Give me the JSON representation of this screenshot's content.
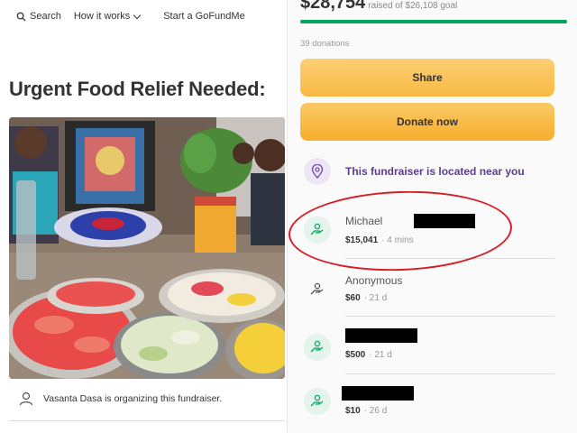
{
  "nav": {
    "search_label": "Search",
    "how_it_works_label": "How it works",
    "start_label": "Start a GoFundMe"
  },
  "campaign": {
    "title": "Urgent Food Relief Needed:",
    "organizer_text": "Vasanta Dasa is organizing this fundraiser."
  },
  "summary": {
    "raised": "$28,754",
    "goal_text": "raised of $26,108 goal",
    "progress_fraction": 1.0,
    "donations_text": "39 donations"
  },
  "buttons": {
    "share_label": "Share",
    "donate_label": "Donate now"
  },
  "location_text": "This fundraiser is located near you",
  "donors": [
    {
      "name": "Michael",
      "amount": "$15,041",
      "time": "4 mins",
      "redacted": true,
      "highlighted": true
    },
    {
      "name": "Anonymous",
      "amount": "$60",
      "time": "21 d",
      "redacted": false
    },
    {
      "name": "",
      "amount": "$500",
      "time": "21 d",
      "redacted": true
    },
    {
      "name": "",
      "amount": "$10",
      "time": "26 d",
      "redacted": true
    }
  ],
  "colors": {
    "accent_green": "#02a95c",
    "button_yellow": "#f6ae2d",
    "location_purple": "#5b3d8f",
    "annotation_red": "#d4202a"
  },
  "icons": {
    "search": "search-icon",
    "chevron": "chevron-down-icon",
    "location": "location-pin-icon",
    "donor": "donation-hand-icon",
    "organizer": "user-icon"
  }
}
